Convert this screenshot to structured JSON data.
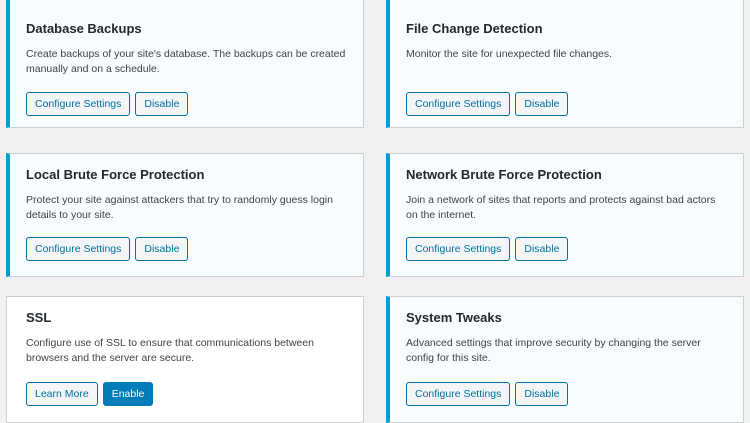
{
  "cards": [
    {
      "title": "Database Backups",
      "description": "Create backups of your site's database. The backups can be created manually and on a schedule.",
      "buttons": [
        "Configure Settings",
        "Disable"
      ]
    },
    {
      "title": "File Change Detection",
      "description": "Monitor the site for unexpected file changes.",
      "buttons": [
        "Configure Settings",
        "Disable"
      ]
    },
    {
      "title": "Local Brute Force Protection",
      "description": "Protect your site against attackers that try to randomly guess login details to your site.",
      "buttons": [
        "Configure Settings",
        "Disable"
      ]
    },
    {
      "title": "Network Brute Force Protection",
      "description": "Join a network of sites that reports and protects against bad actors on the internet.",
      "buttons": [
        "Configure Settings",
        "Disable"
      ]
    },
    {
      "title": "SSL",
      "description": "Configure use of SSL to ensure that communications between browsers and the server are secure.",
      "buttons": [
        "Learn More",
        "Enable"
      ]
    },
    {
      "title": "System Tweaks",
      "description": "Advanced settings that improve security by changing the server config for this site.",
      "buttons": [
        "Configure Settings",
        "Disable"
      ]
    }
  ],
  "colors": {
    "active_border": "#00a0d2",
    "button_text": "#0071a1",
    "primary_button": "#007cba"
  }
}
